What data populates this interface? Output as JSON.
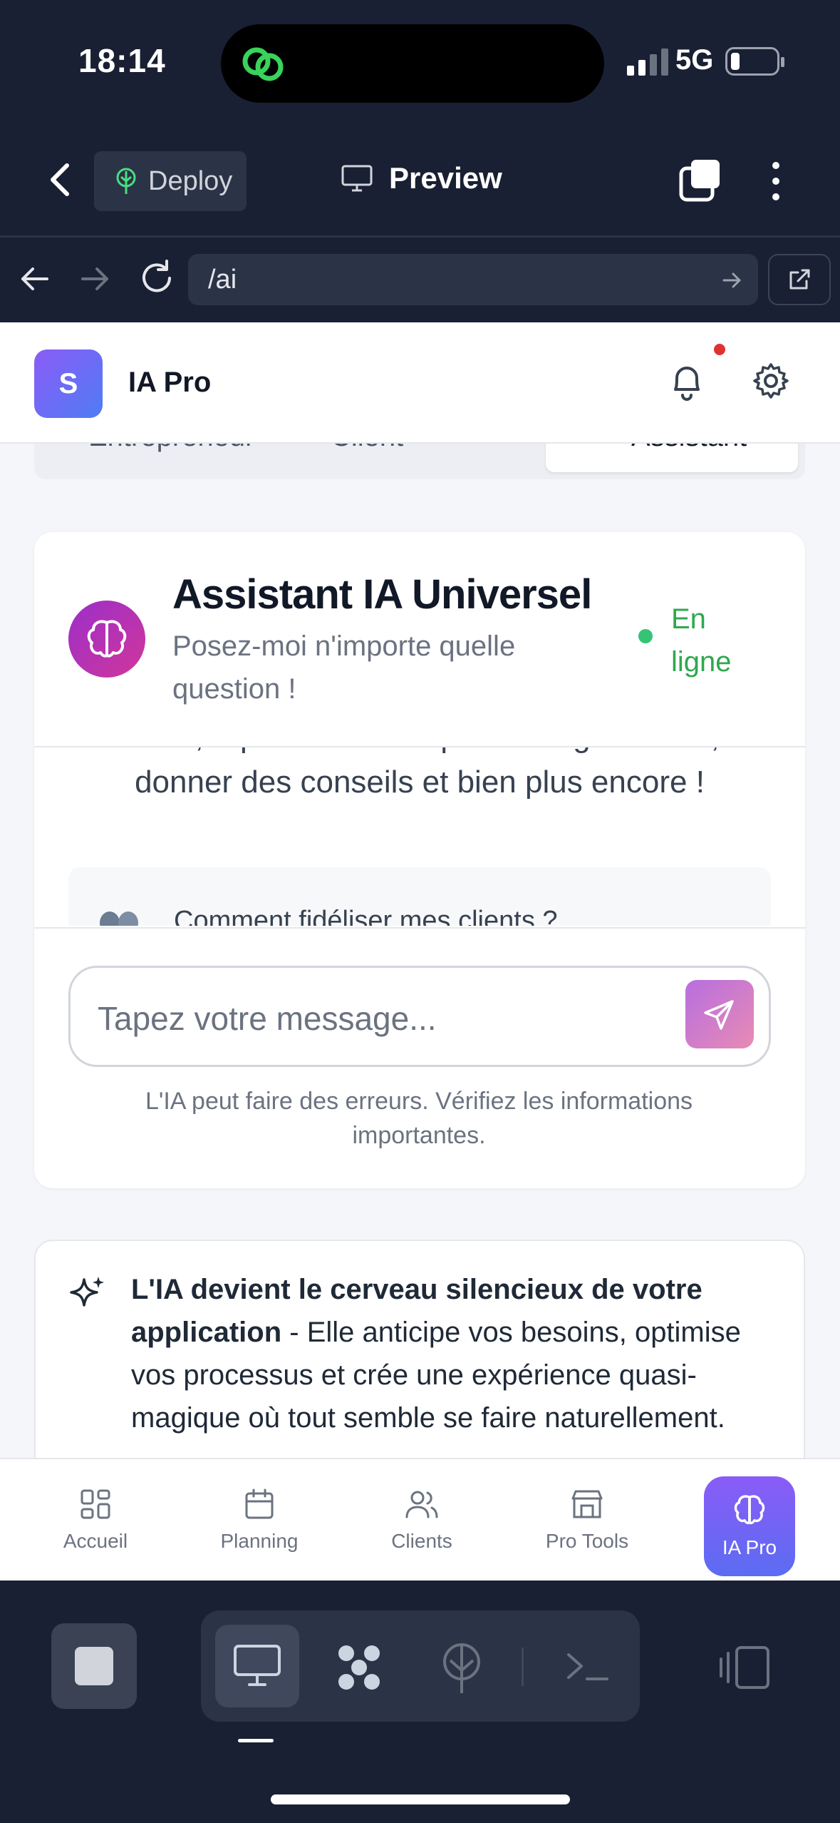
{
  "status_bar": {
    "time": "18:14",
    "network": "5G"
  },
  "toolbar": {
    "deploy_label": "Deploy",
    "preview_label": "Preview"
  },
  "browser": {
    "url": "/ai"
  },
  "app": {
    "avatar_letter": "S",
    "title": "IA Pro",
    "tabs": [
      {
        "label": "Entrepreneur"
      },
      {
        "label": "Client"
      },
      {
        "label": "Assistant"
      }
    ]
  },
  "chat": {
    "title": "Assistant IA Universel",
    "subtitle": "Posez-moi n'importe quelle question !",
    "status": "En ligne",
    "message_cut": "salon, répondre à vos questions générales,",
    "message_line": "donner des conseils et bien plus encore !",
    "suggestion": "Comment fidéliser mes clients ?",
    "input_placeholder": "Tapez votre message...",
    "disclaimer": "L'IA peut faire des erreurs. Vérifiez les informations importantes."
  },
  "info": {
    "bold": "L'IA devient le cerveau silencieux de votre application",
    "text": " - Elle anticipe vos besoins, optimise vos processus et crée une expérience quasi-magique où tout semble se faire naturellement."
  },
  "bottom_nav": [
    {
      "label": "Accueil",
      "icon": "grid-icon"
    },
    {
      "label": "Planning",
      "icon": "calendar-icon"
    },
    {
      "label": "Clients",
      "icon": "users-icon"
    },
    {
      "label": "Pro Tools",
      "icon": "store-icon"
    },
    {
      "label": "IA Pro",
      "icon": "brain-icon",
      "active": true
    }
  ],
  "colors": {
    "background_dark": "#1a2033",
    "accent_purple": "#8b5cf6",
    "online_green": "#2fa84f",
    "notification_red": "#e03131"
  }
}
